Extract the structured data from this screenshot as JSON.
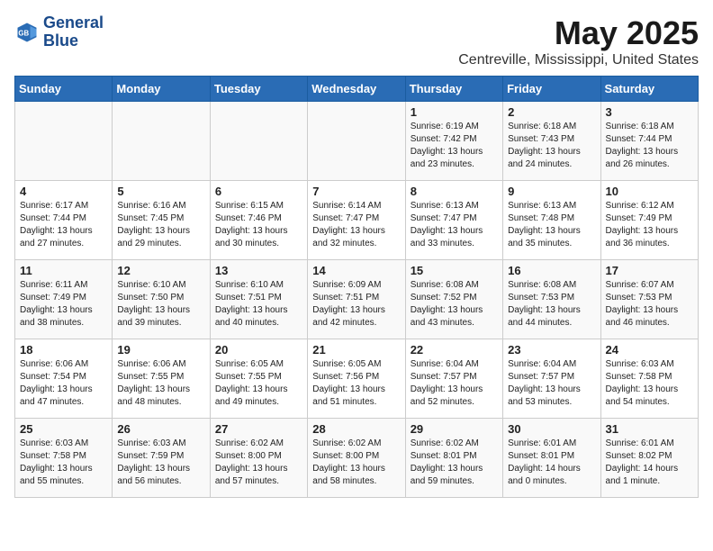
{
  "header": {
    "logo_line1": "General",
    "logo_line2": "Blue",
    "month_title": "May 2025",
    "location": "Centreville, Mississippi, United States"
  },
  "weekdays": [
    "Sunday",
    "Monday",
    "Tuesday",
    "Wednesday",
    "Thursday",
    "Friday",
    "Saturday"
  ],
  "weeks": [
    [
      {
        "day": "",
        "info": ""
      },
      {
        "day": "",
        "info": ""
      },
      {
        "day": "",
        "info": ""
      },
      {
        "day": "",
        "info": ""
      },
      {
        "day": "1",
        "info": "Sunrise: 6:19 AM\nSunset: 7:42 PM\nDaylight: 13 hours\nand 23 minutes."
      },
      {
        "day": "2",
        "info": "Sunrise: 6:18 AM\nSunset: 7:43 PM\nDaylight: 13 hours\nand 24 minutes."
      },
      {
        "day": "3",
        "info": "Sunrise: 6:18 AM\nSunset: 7:44 PM\nDaylight: 13 hours\nand 26 minutes."
      }
    ],
    [
      {
        "day": "4",
        "info": "Sunrise: 6:17 AM\nSunset: 7:44 PM\nDaylight: 13 hours\nand 27 minutes."
      },
      {
        "day": "5",
        "info": "Sunrise: 6:16 AM\nSunset: 7:45 PM\nDaylight: 13 hours\nand 29 minutes."
      },
      {
        "day": "6",
        "info": "Sunrise: 6:15 AM\nSunset: 7:46 PM\nDaylight: 13 hours\nand 30 minutes."
      },
      {
        "day": "7",
        "info": "Sunrise: 6:14 AM\nSunset: 7:47 PM\nDaylight: 13 hours\nand 32 minutes."
      },
      {
        "day": "8",
        "info": "Sunrise: 6:13 AM\nSunset: 7:47 PM\nDaylight: 13 hours\nand 33 minutes."
      },
      {
        "day": "9",
        "info": "Sunrise: 6:13 AM\nSunset: 7:48 PM\nDaylight: 13 hours\nand 35 minutes."
      },
      {
        "day": "10",
        "info": "Sunrise: 6:12 AM\nSunset: 7:49 PM\nDaylight: 13 hours\nand 36 minutes."
      }
    ],
    [
      {
        "day": "11",
        "info": "Sunrise: 6:11 AM\nSunset: 7:49 PM\nDaylight: 13 hours\nand 38 minutes."
      },
      {
        "day": "12",
        "info": "Sunrise: 6:10 AM\nSunset: 7:50 PM\nDaylight: 13 hours\nand 39 minutes."
      },
      {
        "day": "13",
        "info": "Sunrise: 6:10 AM\nSunset: 7:51 PM\nDaylight: 13 hours\nand 40 minutes."
      },
      {
        "day": "14",
        "info": "Sunrise: 6:09 AM\nSunset: 7:51 PM\nDaylight: 13 hours\nand 42 minutes."
      },
      {
        "day": "15",
        "info": "Sunrise: 6:08 AM\nSunset: 7:52 PM\nDaylight: 13 hours\nand 43 minutes."
      },
      {
        "day": "16",
        "info": "Sunrise: 6:08 AM\nSunset: 7:53 PM\nDaylight: 13 hours\nand 44 minutes."
      },
      {
        "day": "17",
        "info": "Sunrise: 6:07 AM\nSunset: 7:53 PM\nDaylight: 13 hours\nand 46 minutes."
      }
    ],
    [
      {
        "day": "18",
        "info": "Sunrise: 6:06 AM\nSunset: 7:54 PM\nDaylight: 13 hours\nand 47 minutes."
      },
      {
        "day": "19",
        "info": "Sunrise: 6:06 AM\nSunset: 7:55 PM\nDaylight: 13 hours\nand 48 minutes."
      },
      {
        "day": "20",
        "info": "Sunrise: 6:05 AM\nSunset: 7:55 PM\nDaylight: 13 hours\nand 49 minutes."
      },
      {
        "day": "21",
        "info": "Sunrise: 6:05 AM\nSunset: 7:56 PM\nDaylight: 13 hours\nand 51 minutes."
      },
      {
        "day": "22",
        "info": "Sunrise: 6:04 AM\nSunset: 7:57 PM\nDaylight: 13 hours\nand 52 minutes."
      },
      {
        "day": "23",
        "info": "Sunrise: 6:04 AM\nSunset: 7:57 PM\nDaylight: 13 hours\nand 53 minutes."
      },
      {
        "day": "24",
        "info": "Sunrise: 6:03 AM\nSunset: 7:58 PM\nDaylight: 13 hours\nand 54 minutes."
      }
    ],
    [
      {
        "day": "25",
        "info": "Sunrise: 6:03 AM\nSunset: 7:58 PM\nDaylight: 13 hours\nand 55 minutes."
      },
      {
        "day": "26",
        "info": "Sunrise: 6:03 AM\nSunset: 7:59 PM\nDaylight: 13 hours\nand 56 minutes."
      },
      {
        "day": "27",
        "info": "Sunrise: 6:02 AM\nSunset: 8:00 PM\nDaylight: 13 hours\nand 57 minutes."
      },
      {
        "day": "28",
        "info": "Sunrise: 6:02 AM\nSunset: 8:00 PM\nDaylight: 13 hours\nand 58 minutes."
      },
      {
        "day": "29",
        "info": "Sunrise: 6:02 AM\nSunset: 8:01 PM\nDaylight: 13 hours\nand 59 minutes."
      },
      {
        "day": "30",
        "info": "Sunrise: 6:01 AM\nSunset: 8:01 PM\nDaylight: 14 hours\nand 0 minutes."
      },
      {
        "day": "31",
        "info": "Sunrise: 6:01 AM\nSunset: 8:02 PM\nDaylight: 14 hours\nand 1 minute."
      }
    ]
  ]
}
